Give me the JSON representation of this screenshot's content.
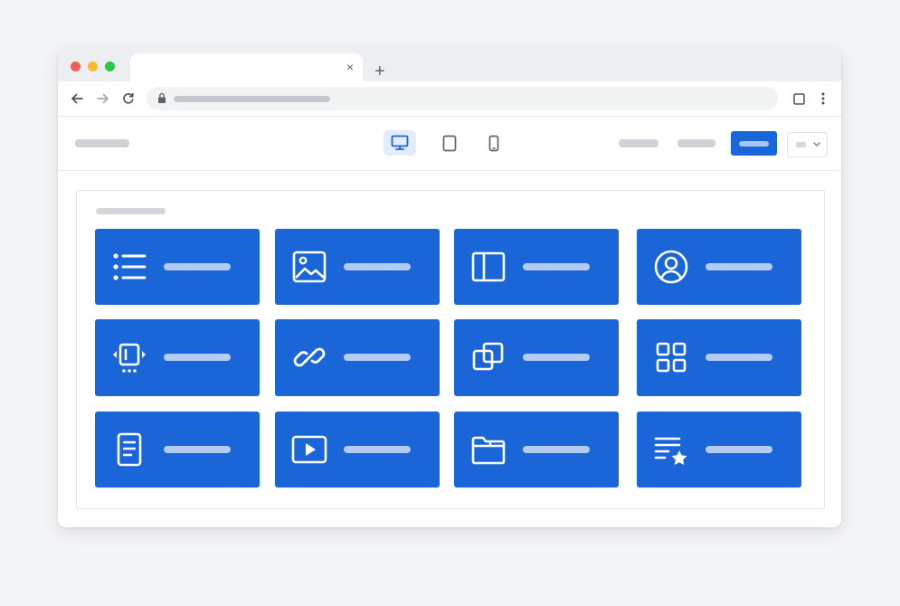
{
  "browser": {
    "tab": {
      "close_glyph": "×"
    },
    "new_tab_glyph": "+",
    "traffic_lights": [
      "#ee5f57",
      "#f5bd2e",
      "#28c840"
    ]
  },
  "toolbar": {
    "back_icon": "arrow-left-icon",
    "forward_icon": "arrow-right-icon",
    "reload_icon": "reload-icon",
    "lock_icon": "lock-icon"
  },
  "header": {
    "devices": [
      {
        "name": "desktop-icon",
        "active": true
      },
      {
        "name": "tablet-icon",
        "active": false
      },
      {
        "name": "mobile-icon",
        "active": false
      }
    ],
    "dropdown_icon": "chevron-down-icon"
  },
  "blocks": [
    {
      "icon": "list-icon"
    },
    {
      "icon": "image-icon"
    },
    {
      "icon": "sidebar-layout-icon"
    },
    {
      "icon": "user-circle-icon"
    },
    {
      "icon": "carousel-icon"
    },
    {
      "icon": "link-icon"
    },
    {
      "icon": "overlap-squares-icon"
    },
    {
      "icon": "grid-icon"
    },
    {
      "icon": "document-icon"
    },
    {
      "icon": "video-icon"
    },
    {
      "icon": "folder-icon"
    },
    {
      "icon": "featured-list-icon"
    }
  ],
  "colors": {
    "accent": "#1a66d9",
    "active_device_bg": "#e3ecfb",
    "placeholder": "#cfd2d6"
  }
}
